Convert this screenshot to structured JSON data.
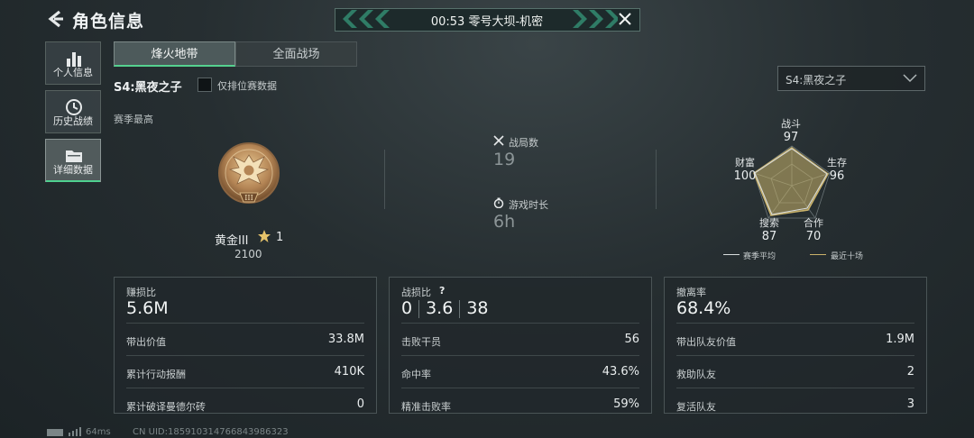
{
  "header": {
    "title": "角色信息",
    "banner_text": "00:53  零号大坝-机密"
  },
  "nav": {
    "items": [
      {
        "label": "个人信息",
        "icon": "bar-chart-icon"
      },
      {
        "label": "历史战绩",
        "icon": "clock-history-icon"
      },
      {
        "label": "详细数据",
        "icon": "folder-icon",
        "active": true
      }
    ]
  },
  "tabs": {
    "active": "烽火地带",
    "inactive": "全面战场"
  },
  "season": {
    "name": "S4:黑夜之子",
    "ranked_only_label": "仅排位赛数据",
    "ranked_only_checked": false,
    "select_value": "S4:黑夜之子"
  },
  "best": {
    "section_label": "赛季最高",
    "rank_name": "黄金III",
    "rank_badge_numeral": "III",
    "stars": "1",
    "score": "2100"
  },
  "summary": {
    "matches_label": "战局数",
    "matches_value": "19",
    "playtime_label": "游戏时长",
    "playtime_value": "6h"
  },
  "radar": {
    "axes": [
      {
        "label": "战斗",
        "value": "97"
      },
      {
        "label": "生存",
        "value": "96"
      },
      {
        "label": "合作",
        "value": "70"
      },
      {
        "label": "搜索",
        "value": "87"
      },
      {
        "label": "财富",
        "value": "100"
      }
    ],
    "legend_season": "赛季平均",
    "legend_recent": "最近十场",
    "colors": {
      "season": "#d8dcdd",
      "recent": "#c9b26a"
    }
  },
  "panels": {
    "profit": {
      "title": "赚损比",
      "value": "5.6M",
      "rows": [
        {
          "k": "带出价值",
          "v": "33.8M"
        },
        {
          "k": "累计行动报酬",
          "v": "410K"
        },
        {
          "k": "累计破译曼德尔砖",
          "v": "0"
        }
      ]
    },
    "combat": {
      "title": "战损比",
      "help": "?",
      "ratio": [
        "0",
        "3.6",
        "38"
      ],
      "rows": [
        {
          "k": "击败干员",
          "v": "56"
        },
        {
          "k": "命中率",
          "v": "43.6%"
        },
        {
          "k": "精准击败率",
          "v": "59%"
        }
      ]
    },
    "extract": {
      "title": "撤离率",
      "value": "68.4%",
      "rows": [
        {
          "k": "带出队友价值",
          "v": "1.9M"
        },
        {
          "k": "救助队友",
          "v": "2"
        },
        {
          "k": "复活队友",
          "v": "3"
        }
      ]
    }
  },
  "footer": {
    "ping": "64ms",
    "uid": "CN UID:1859103147668439863​23"
  }
}
